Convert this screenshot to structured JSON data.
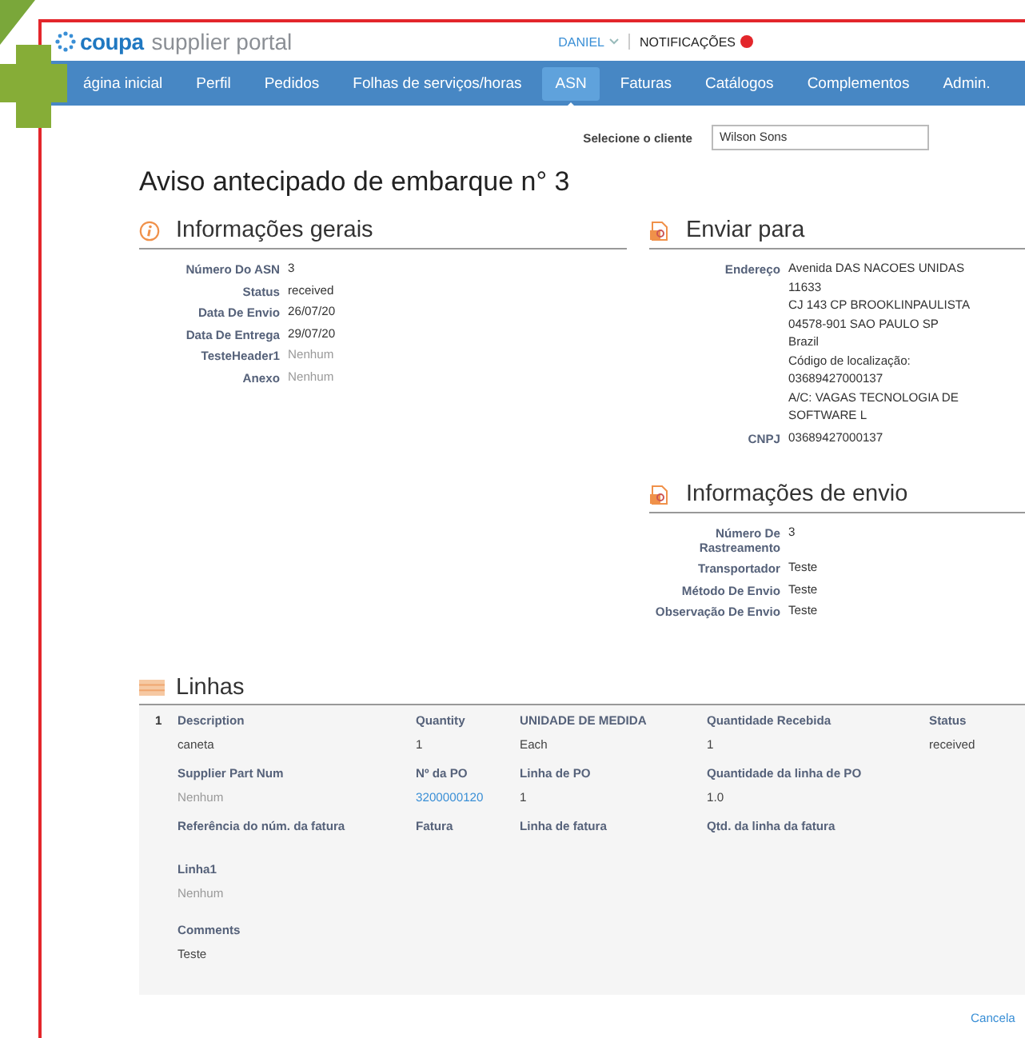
{
  "header": {
    "logo_brand": "coupa",
    "logo_product": "supplier portal",
    "user": "DANIEL",
    "notifications": "NOTIFICAÇÕES"
  },
  "nav": [
    {
      "label": "ágina inicial",
      "selected": false
    },
    {
      "label": "Perfil",
      "selected": false
    },
    {
      "label": "Pedidos",
      "selected": false
    },
    {
      "label": "Folhas de serviços/horas",
      "selected": false
    },
    {
      "label": "ASN",
      "selected": true
    },
    {
      "label": "Faturas",
      "selected": false
    },
    {
      "label": "Catálogos",
      "selected": false
    },
    {
      "label": "Complementos",
      "selected": false
    },
    {
      "label": "Admin.",
      "selected": false
    }
  ],
  "client_selector": {
    "label": "Selecione o cliente",
    "value": "Wilson Sons"
  },
  "page_title": "Aviso antecipado de embarque n° 3",
  "general_info": {
    "title": "Informações gerais",
    "fields": [
      {
        "label": "Número Do ASN",
        "value": [
          "3"
        ],
        "muted": false
      },
      {
        "label": "Status",
        "value": [
          "received"
        ],
        "muted": false
      },
      {
        "label": "Data De Envio",
        "value": [
          "26/07/20"
        ],
        "muted": false
      },
      {
        "label": "Data De Entrega",
        "value": [
          "29/07/20"
        ],
        "muted": false
      },
      {
        "label": "TesteHeader1",
        "value": [
          "Nenhum"
        ],
        "muted": true
      },
      {
        "label": "Anexo",
        "value": [
          "Nenhum"
        ],
        "muted": true
      }
    ]
  },
  "ship_to": {
    "title": "Enviar para",
    "fields": [
      {
        "label": "Endereço",
        "value": [
          "Avenida DAS NACOES UNIDAS",
          "11633",
          "CJ 143 CP BROOKLINPAULISTA",
          "04578-901 SAO PAULO SP",
          "Brazil",
          "Código de localização:",
          "03689427000137",
          "A/C: VAGAS TECNOLOGIA DE",
          "SOFTWARE L"
        ],
        "muted": false
      },
      {
        "label": "CNPJ",
        "value": [
          "03689427000137"
        ],
        "muted": false
      }
    ]
  },
  "shipping_info": {
    "title": "Informações de envio",
    "fields": [
      {
        "label": "Número De Rastreamento",
        "value": [
          "3"
        ],
        "muted": false
      },
      {
        "label": "Transportador",
        "value": [
          "Teste"
        ],
        "muted": false
      },
      {
        "label": "Método De Envio",
        "value": [
          "Teste"
        ],
        "muted": false
      },
      {
        "label": "Observação De Envio",
        "value": [
          "Teste"
        ],
        "muted": false
      }
    ]
  },
  "lines": {
    "title": "Linhas",
    "items": [
      {
        "number": "1",
        "rows": [
          [
            {
              "label": "Description",
              "value": "caneta",
              "kind": "text"
            },
            {
              "label": "Quantity",
              "value": "1",
              "kind": "text"
            },
            {
              "label": "UNIDADE DE MEDIDA",
              "value": "Each",
              "kind": "text"
            },
            {
              "label": "Quantidade Recebida",
              "value": "1",
              "kind": "text"
            },
            {
              "label": "Status",
              "value": "received",
              "kind": "text"
            }
          ],
          [
            {
              "label": "Supplier Part Num",
              "value": "Nenhum",
              "kind": "muted"
            },
            {
              "label": "Nº da PO",
              "value": "3200000120",
              "kind": "link"
            },
            {
              "label": "Linha de PO",
              "value": "1",
              "kind": "text"
            },
            {
              "label": "Quantidade da linha de PO",
              "value": "1.0",
              "kind": "text"
            }
          ],
          [
            {
              "label": "Referência do núm. da fatura"
            },
            {
              "label": "Fatura"
            },
            {
              "label": "Linha de fatura"
            },
            {
              "label": "Qtd. da linha da fatura"
            }
          ],
          [
            {
              "label": "Linha1",
              "value": "Nenhum",
              "kind": "muted"
            }
          ],
          [
            {
              "label": "Comments",
              "value": "Teste",
              "kind": "text"
            }
          ]
        ]
      }
    ]
  },
  "cancel_link": "Cancela"
}
